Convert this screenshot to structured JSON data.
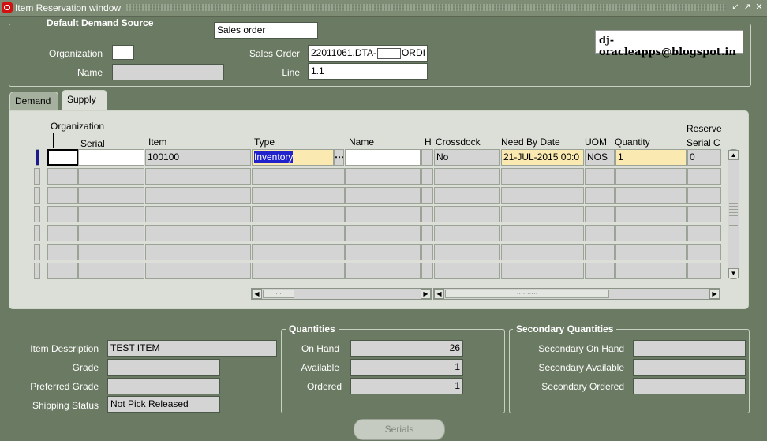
{
  "window": {
    "title": "Item Reservation window"
  },
  "blog": "dj-oracleapps@blogspot.in",
  "demand_source": {
    "group_title": "Default Demand Source",
    "type_value": "Sales order",
    "organization_label": "Organization",
    "organization_value": "",
    "name_label": "Name",
    "name_value": "",
    "sales_order_label": "Sales Order",
    "sales_order_prefix": "22011061.DTA-",
    "sales_order_suffix": "ORDI",
    "line_label": "Line",
    "line_value": "1.1"
  },
  "tabs": {
    "demand": "Demand",
    "supply": "Supply"
  },
  "grid": {
    "headers": {
      "organization": "Organization",
      "serial": "Serial",
      "item": "Item",
      "type": "Type",
      "name": "Name",
      "h": "H",
      "crossdock": "Crossdock",
      "need_by_date": "Need By Date",
      "uom": "UOM",
      "quantity": "Quantity",
      "reserve": "Reserve",
      "serial_c": "Serial C"
    },
    "row1": {
      "organization": "",
      "serial": "",
      "item": "100100",
      "type": "Inventory",
      "name": "",
      "h": "",
      "crossdock": "No",
      "need_by_date": "21-JUL-2015 00:0",
      "uom": "NOS",
      "quantity": "1",
      "reserve_serial": "0"
    },
    "lov_icon": "ellipsis-icon"
  },
  "item_info": {
    "item_description_label": "Item Description",
    "item_description_value": "TEST ITEM",
    "grade_label": "Grade",
    "grade_value": "",
    "preferred_grade_label": "Preferred Grade",
    "preferred_grade_value": "",
    "shipping_status_label": "Shipping Status",
    "shipping_status_value": "Not Pick Released"
  },
  "quantities": {
    "title": "Quantities",
    "on_hand_label": "On Hand",
    "on_hand_value": "26",
    "available_label": "Available",
    "available_value": "1",
    "ordered_label": "Ordered",
    "ordered_value": "1"
  },
  "secondary_quantities": {
    "title": "Secondary Quantities",
    "on_hand_label": "Secondary On Hand",
    "on_hand_value": "",
    "available_label": "Secondary Available",
    "available_value": "",
    "ordered_label": "Secondary Ordered",
    "ordered_value": ""
  },
  "serials_button": "Serials"
}
